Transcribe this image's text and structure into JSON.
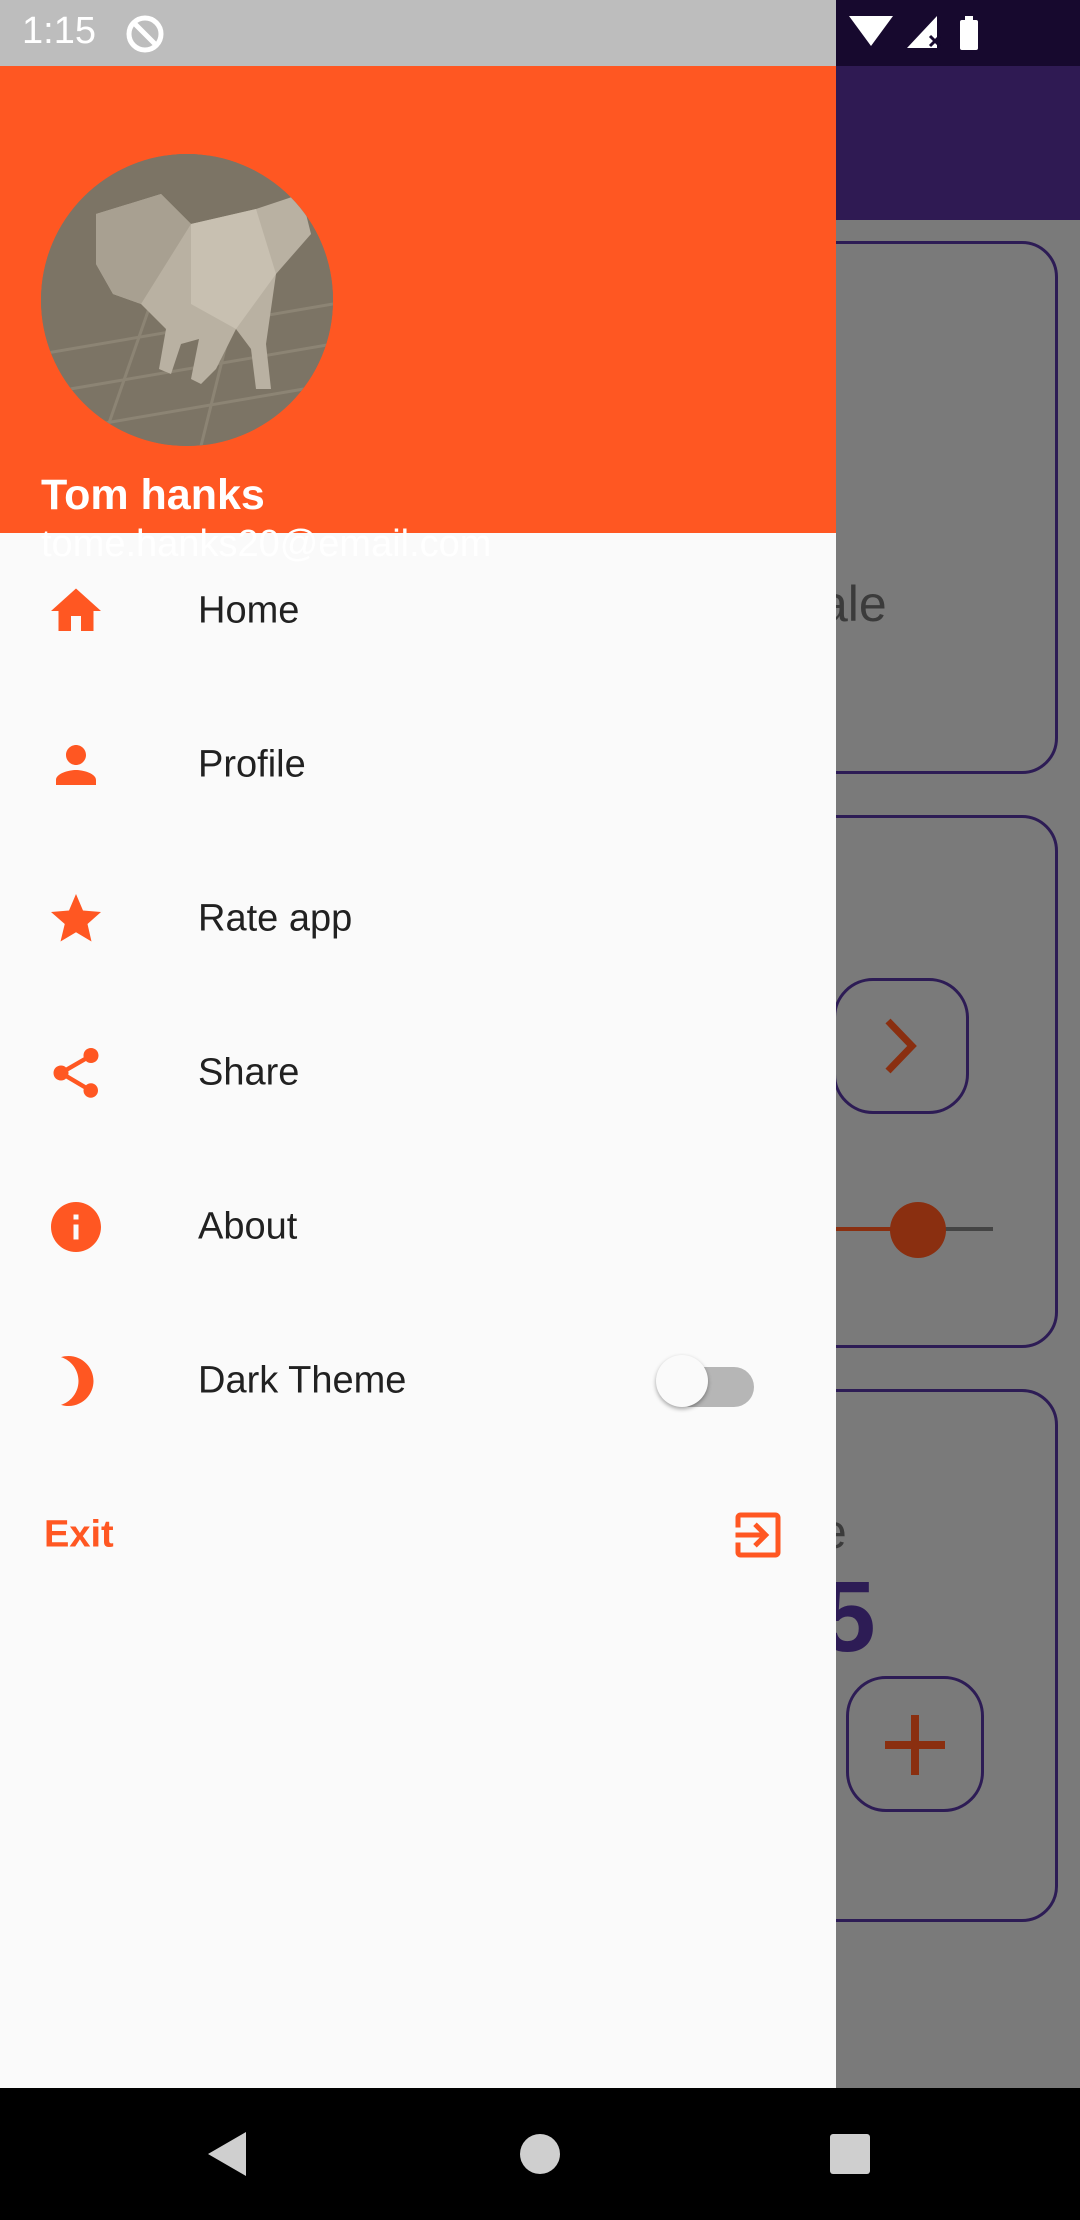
{
  "status_bar": {
    "time": "1:15"
  },
  "drawer_header": {
    "user_name": "Tom hanks",
    "user_email": "tome.hanks20@email.com"
  },
  "menu": [
    {
      "label": "Home",
      "icon": "home-icon"
    },
    {
      "label": "Profile",
      "icon": "person-icon"
    },
    {
      "label": "Rate app",
      "icon": "star-icon"
    },
    {
      "label": "Share",
      "icon": "share-icon"
    },
    {
      "label": "About",
      "icon": "info-icon"
    },
    {
      "label": "Dark Theme",
      "icon": "moon-icon",
      "toggle_on": false
    }
  ],
  "exit": {
    "label": "Exit",
    "icon": "logout-icon"
  },
  "background": {
    "partial_text_1": "ale",
    "partial_text_2": "e",
    "partial_number": "5"
  },
  "colors": {
    "accent": "#ff5722",
    "primary_dark": "#2f1a53",
    "drawer_bg": "#fafafa"
  }
}
